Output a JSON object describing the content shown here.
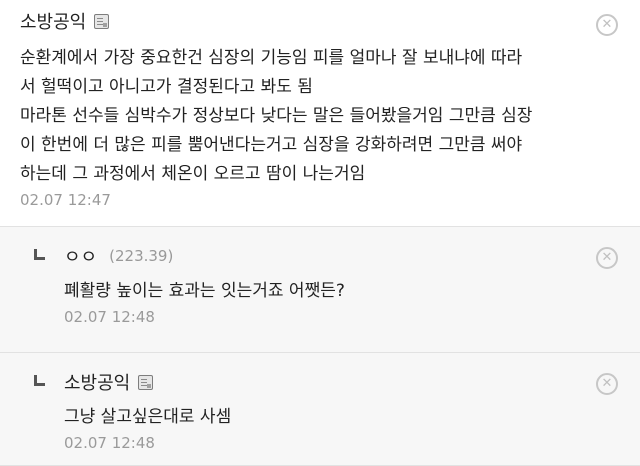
{
  "comments": {
    "top": {
      "nickname": "소방공익",
      "text": "순환계에서 가장 중요한건 심장의 기능임 피를 얼마나 잘 보내냐에 따라\n서 헐떡이고 아니고가 결정된다고 봐도 됨\n마라톤 선수들 심박수가 정상보다 낮다는 말은 들어봤을거임 그만큼 심장\n이 한번에 더 많은 피를 뿜어낸다는거고 심장을 강화하려면 그만큼 써야\n하는데 그 과정에서 체온이 오르고 땀이 나는거임",
      "date": "02.07 12:47",
      "delete_glyph": "✕"
    },
    "reply1": {
      "nickname": "ㅇㅇ",
      "ip": "(223.39)",
      "text": "폐활량 높이는 효과는 잇는거죠 어쨋든?",
      "date": "02.07 12:48",
      "delete_glyph": "✕"
    },
    "reply2": {
      "nickname": "소방공익",
      "text": "그냥 살고싶은대로 사셈",
      "date": "02.07 12:48",
      "delete_glyph": "✕"
    }
  },
  "icons": {
    "memo": "memo-icon",
    "reply": "reply-arrow-icon",
    "delete": "close-circle-icon"
  },
  "colors": {
    "reply_bg": "#f7f7f7",
    "date": "#9a9a9a",
    "text": "#222222"
  }
}
